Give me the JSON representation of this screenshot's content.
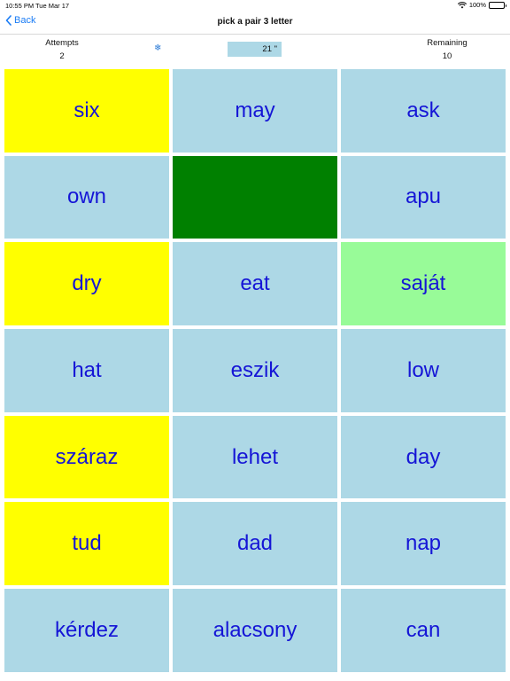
{
  "status_bar": {
    "time": "10:55 PM",
    "date": "Tue Mar 17",
    "battery": "100%",
    "wifi_icon": "wifi-icon",
    "battery_icon": "battery-icon"
  },
  "nav": {
    "back_label": "Back",
    "back_icon": "chevron-left-icon",
    "title": "pick a pair 3 letter"
  },
  "stats": {
    "attempts_label": "Attempts",
    "attempts_value": "2",
    "remaining_label": "Remaining",
    "remaining_value": "10",
    "timer": "21 \"",
    "snow_icon": "snowflake-icon"
  },
  "colors": {
    "card_default": "#add8e6",
    "card_selected": "#ffff00",
    "card_matched": "#008000",
    "card_highlight": "#98fb98",
    "card_text": "#1515d6",
    "accent": "#1a7cf5"
  },
  "cards": [
    {
      "label": "six",
      "state": "yellow"
    },
    {
      "label": "may",
      "state": "blue"
    },
    {
      "label": "ask",
      "state": "blue"
    },
    {
      "label": "own",
      "state": "blue"
    },
    {
      "label": "",
      "state": "green"
    },
    {
      "label": "apu",
      "state": "blue"
    },
    {
      "label": "dry",
      "state": "yellow"
    },
    {
      "label": "eat",
      "state": "blue"
    },
    {
      "label": "saját",
      "state": "lightgreen"
    },
    {
      "label": "hat",
      "state": "blue"
    },
    {
      "label": "eszik",
      "state": "blue"
    },
    {
      "label": "low",
      "state": "blue"
    },
    {
      "label": "száraz",
      "state": "yellow"
    },
    {
      "label": "lehet",
      "state": "blue"
    },
    {
      "label": "day",
      "state": "blue"
    },
    {
      "label": "tud",
      "state": "yellow"
    },
    {
      "label": "dad",
      "state": "blue"
    },
    {
      "label": "nap",
      "state": "blue"
    },
    {
      "label": "kérdez",
      "state": "blue"
    },
    {
      "label": "alacsony",
      "state": "blue"
    },
    {
      "label": "can",
      "state": "blue"
    }
  ]
}
